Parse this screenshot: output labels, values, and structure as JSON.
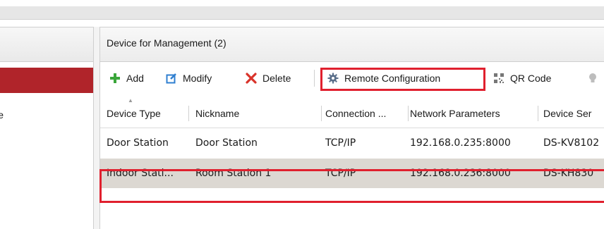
{
  "main": {
    "title": "Device for Management (2)"
  },
  "left_panel": {
    "item_fragment": "e"
  },
  "toolbar": {
    "add_label": "Add",
    "modify_label": "Modify",
    "delete_label": "Delete",
    "remote_config_label": "Remote Configuration",
    "qr_label": "QR Code"
  },
  "table": {
    "columns": [
      "Device Type",
      "Nickname",
      "Connection ...",
      "Network Parameters",
      "Device Ser"
    ],
    "sort_column": "Device Type",
    "rows": [
      {
        "device_type": "Door Station",
        "nickname": "Door Station",
        "connection": "TCP/IP",
        "network": "192.168.0.235:8000",
        "serial": "DS-KV8102"
      },
      {
        "device_type": "Indoor Stati...",
        "nickname": "Room Station 1",
        "connection": "TCP/IP",
        "network": "192.168.0.236:8000",
        "serial": "DS-KH830"
      }
    ],
    "selected_row": 1
  },
  "colors": {
    "accent_red": "#b0242a",
    "highlight_red": "#e0202e",
    "add_green": "#3aa63a",
    "modify_blue": "#2f7fd0",
    "delete_red": "#d9332a",
    "selected_row_bg": "#dcd8d2"
  },
  "icons": {
    "add": "plus-icon",
    "modify": "edit-icon",
    "delete": "x-icon",
    "remote": "gear-icon",
    "qr": "qr-code-icon",
    "more": "bulb-icon"
  }
}
